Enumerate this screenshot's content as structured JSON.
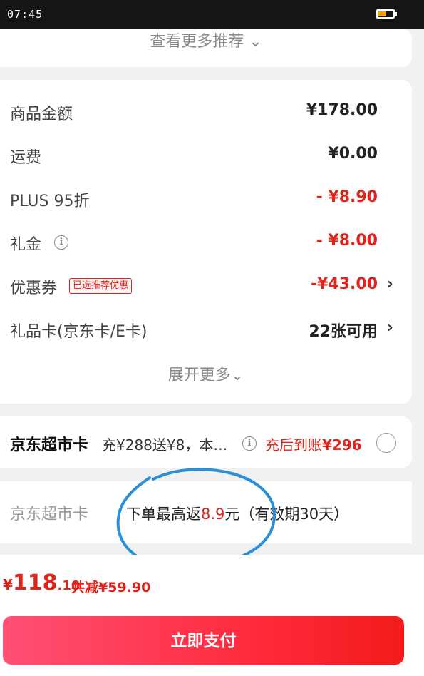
{
  "status_bar": {
    "time": "07:45",
    "battery_level": 0.55,
    "battery_color": "#f4a300"
  },
  "recommend": {
    "see_more": "查看更多推荐",
    "chevron": "⌄"
  },
  "price_rows": [
    {
      "label": "商品金额",
      "value": "¥178.00"
    },
    {
      "label": "运费",
      "value": "¥0.00"
    },
    {
      "label": "PLUS 95折",
      "value": "- ¥8.90"
    },
    {
      "label": "礼金",
      "value": "- ¥8.00"
    },
    {
      "label": "优惠券",
      "badge": "已选推荐优惠",
      "value": "-¥43.00"
    },
    {
      "label": "礼品卡(京东卡/E卡)",
      "value": "22张可用"
    }
  ],
  "expand_more": "展开更多⌄",
  "supermarket_card": {
    "title": "京东超市卡",
    "desc": "充¥288送¥8，本…",
    "value_prefix": "充后到账",
    "value": "¥296"
  },
  "rebate": {
    "label": "京东超市卡",
    "text_before": "下单最高返",
    "amount": "8.9",
    "text_after": "元（有效期30天）"
  },
  "bottom": {
    "currency": "¥",
    "total_int": "118",
    "total_dec": ".10",
    "saved": "共减¥59.90",
    "pay_label": "立即支付"
  },
  "colors": {
    "accent": "#e2231a",
    "annotation": "#2a8fd8"
  }
}
